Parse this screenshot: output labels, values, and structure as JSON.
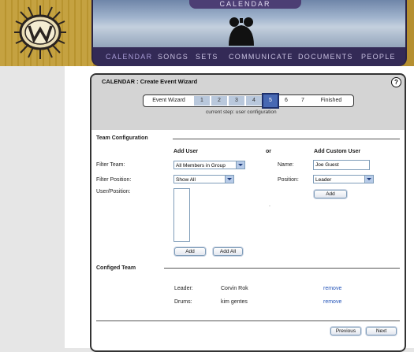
{
  "header": {
    "calendar_tab": "CALENDAR",
    "nav": [
      "CALENDAR",
      "SONGS",
      "SETS",
      "COMMUNICATE",
      "DOCUMENTS",
      "PEOPLE"
    ]
  },
  "panel": {
    "title": "CALENDAR : Create Event Wizard",
    "help": "?",
    "steps": [
      "Event Wizard",
      "1",
      "2",
      "3",
      "4",
      "5",
      "6",
      "7",
      "Finished"
    ],
    "current_step_index": 5,
    "current_step_text": "current step: user configuration"
  },
  "team_config": {
    "section_title": "Team Configuration",
    "add_user_heading": "Add User",
    "or_text": "or",
    "add_custom_heading": "Add Custom User",
    "filter_team_label": "Filter Team:",
    "filter_team_value": "All Members in Group",
    "filter_position_label": "Filter Position:",
    "filter_position_value": "Show All",
    "user_position_label": "User/Position:",
    "name_label": "Name:",
    "name_value": "Joe Guest",
    "position_label": "Position:",
    "position_value": "Leader",
    "add_custom_button": "Add",
    "add_button": "Add",
    "add_all_button": "Add All",
    "dot": "."
  },
  "configed_team": {
    "section_title": "Configed Team",
    "members": [
      {
        "role": "Leader:",
        "name": "Corvin Rok",
        "action": "remove"
      },
      {
        "role": "Drums:",
        "name": "kim gentes",
        "action": "remove"
      }
    ]
  },
  "footer": {
    "previous": "Previous",
    "next": "Next"
  }
}
